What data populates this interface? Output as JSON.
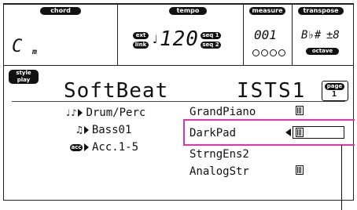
{
  "header": {
    "chord_label": "chord",
    "chord_value": "C",
    "chord_quality": "m",
    "tempo_label": "tempo",
    "ext_label": "ext",
    "link_label": "link",
    "tempo_value": "120",
    "seq1_label": "seq 1",
    "seq2_label": "seq 2",
    "measure_label": "measure",
    "measure_value": "001",
    "transpose_label": "transpose",
    "transpose_symbols": "B♭#",
    "transpose_value": "±8",
    "octave_label": "octave"
  },
  "style": {
    "badge": "style play",
    "name": "SoftBeat",
    "bank": "ISTS1",
    "page_label": "page",
    "page_value": "1"
  },
  "tracks": [
    {
      "label": "Drum/Perc",
      "icon": "drum-kit-icon",
      "sound": "GrandPiano"
    },
    {
      "label": "Bass01",
      "icon": "bass-guitar-icon",
      "sound": "DarkPad"
    },
    {
      "label": "Acc.1-5",
      "icon": "acc-icon",
      "sound": "StrngEns2"
    },
    {
      "label": "",
      "icon": "",
      "sound": "AnalogStr"
    }
  ],
  "acc_badge": "acc",
  "colors": {
    "highlight": "#d63aa6",
    "lcd_ink": "#111111"
  }
}
